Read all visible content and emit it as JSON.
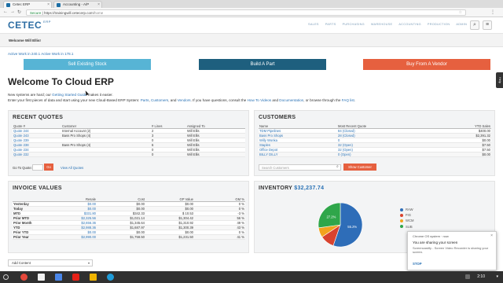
{
  "browser": {
    "tabs": [
      {
        "title": "Cetec ERP",
        "active": true
      },
      {
        "title": "Accounting - A/P",
        "active": false
      }
    ],
    "url_secure": "Secure",
    "url_host": "https://trainingwill.cetecerp.com",
    "url_path": "/home"
  },
  "app": {
    "logo_main": "CETEC",
    "logo_sub": "ERP",
    "nav": [
      "SALES",
      "PARTS",
      "PURCHASING",
      "WAREHOUSE",
      "ACCOUNTING",
      "PRODUCTION",
      "ADMIN"
    ],
    "welcome_user": "Welcome Will Ellis!",
    "version_line": "Active Work in 240.1 Active Work in 178.1",
    "action_buttons": [
      {
        "label": "Sell Existing Stock",
        "color": "#57b4d5"
      },
      {
        "label": "Build A Part",
        "color": "#1e5f7e"
      },
      {
        "label": "Buy From A Vendor",
        "color": "#e6603f"
      }
    ],
    "help_tab": "Help"
  },
  "intro": {
    "title": "Welcome To Cloud ERP",
    "line1_pre": "New systems are hard; our ",
    "line1_link": "Getting Started Guide",
    "line1_post": " makes it easier.",
    "line2_a": "Enter your first pieces of data and start using your new Cloud-Based ERP System: ",
    "line2_parts": "Parts",
    "line2_sep1": ", ",
    "line2_customers": "Customers",
    "line2_sep2": ", and ",
    "line2_vendors": "Vendors",
    "line2_b": ". If you have questions, consult the ",
    "line2_howto": "How To Videos",
    "line2_and": " and ",
    "line2_docs": "Documentation",
    "line2_c": ", or browse through the ",
    "line2_faq": "FAQ list",
    "line2_d": "."
  },
  "quotes": {
    "heading": "RECENT QUOTES",
    "columns": [
      "Quote #",
      "Customer",
      "# Lines",
      "Assigned To"
    ],
    "rows": [
      [
        "Quote 244",
        "Internal Account (2)",
        "2",
        "Will Ellis"
      ],
      [
        "Quote 243",
        "Bass Pro Shops (4)",
        "3",
        "Will Ellis"
      ],
      [
        "Quote 239",
        "",
        "0",
        "Will Ellis"
      ],
      [
        "Quote 238",
        "Bass Pro Shops (4)",
        "6",
        "Will Ellis"
      ],
      [
        "Quote 234",
        "",
        "0",
        "Will Ellis"
      ],
      [
        "Quote 232",
        "",
        "0",
        "Will Ellis"
      ]
    ],
    "goto_label": "Go To Quote:",
    "go_button": "Go",
    "view_all": "View All Quotes"
  },
  "customers": {
    "heading": "CUSTOMERS",
    "columns": [
      "Name",
      "Most Recent Quote",
      "YTD Sales"
    ],
    "rows": [
      [
        "TDM Pipelines",
        "84 (Closed)",
        "$400.00"
      ],
      [
        "Bass Pro Shops",
        "28 (Closed)",
        "$2,391.32"
      ],
      [
        "Willy Wonka",
        "0",
        "$0.00"
      ],
      [
        "Staples",
        "32 (Open)",
        "$7.50"
      ],
      [
        "Office Depot",
        "32 (Open)",
        "$7.50"
      ],
      [
        "BILLY DILLY",
        "0 (Open)",
        "$0.00"
      ]
    ],
    "search_placeholder": "Search Customers",
    "show_button": "Show Customer"
  },
  "invoice": {
    "heading": "INVOICE VALUES",
    "columns": [
      "",
      "Resale",
      "Cost",
      "GP Value",
      "GM %"
    ],
    "rows": [
      [
        "Yesterday",
        "$0.00",
        "$0.00",
        "$0.00",
        "0 %"
      ],
      [
        "Today",
        "$0.00",
        "$0.00",
        "$0.00",
        "0 %"
      ],
      [
        "MTD",
        "$331.80",
        "$342.33",
        "$ 10.53",
        "-3 %"
      ],
      [
        "Prior MTD",
        "$2,325.56",
        "$1,021.14",
        "$1,304.42",
        "56 %"
      ],
      [
        "Prior Month",
        "$2,656.36",
        "$1,345.64",
        "$1,310.92",
        "49 %"
      ],
      [
        "YTD",
        "$2,988.36",
        "$1,687.97",
        "$1,300.39",
        "43 %"
      ],
      [
        "Prior YTD",
        "$0.00",
        "$0.00",
        "$0.00",
        "0 %"
      ],
      [
        "Prior Year",
        "$2,990.00",
        "$1,758.50",
        "$1,231.50",
        "41 %"
      ]
    ]
  },
  "inventory": {
    "heading_label": "INVENTORY",
    "heading_value": "$32,237.74",
    "legend": [
      {
        "name": "RAW",
        "color": "#2e6db8"
      },
      {
        "name": "FIG",
        "color": "#d8432e"
      },
      {
        "name": "WCM",
        "color": "#f2a31d"
      },
      {
        "name": "SUB",
        "color": "#2fa64a"
      }
    ]
  },
  "chart_data": {
    "type": "pie",
    "categories": [
      "RAW",
      "FIG",
      "WCM",
      "SUB"
    ],
    "values": [
      55.2,
      10.5,
      7.1,
      27.2
    ],
    "slice_labels": [
      "55.2%",
      "",
      "",
      "27.2%"
    ],
    "colors": [
      "#2e6db8",
      "#d8432e",
      "#f2a31d",
      "#2fa64a"
    ],
    "legend_position": "right"
  },
  "add_content": {
    "label": "Add Content"
  },
  "notification": {
    "header": "Chrome OS system · now",
    "title": "You are sharing your screen",
    "body": "Screencastify - Screen Video Recorder is sharing your screen.",
    "stop": "STOP"
  },
  "taskbar": {
    "time": "2:10",
    "icons": [
      {
        "name": "chrome",
        "color": "#e5483b"
      },
      {
        "name": "gmail",
        "color": "#f2f2f2"
      },
      {
        "name": "docs",
        "color": "#4a86e8"
      },
      {
        "name": "youtube",
        "color": "#e62117"
      },
      {
        "name": "files",
        "color": "#f0b400"
      },
      {
        "name": "screencastify",
        "color": "#1f9bd8"
      }
    ]
  }
}
